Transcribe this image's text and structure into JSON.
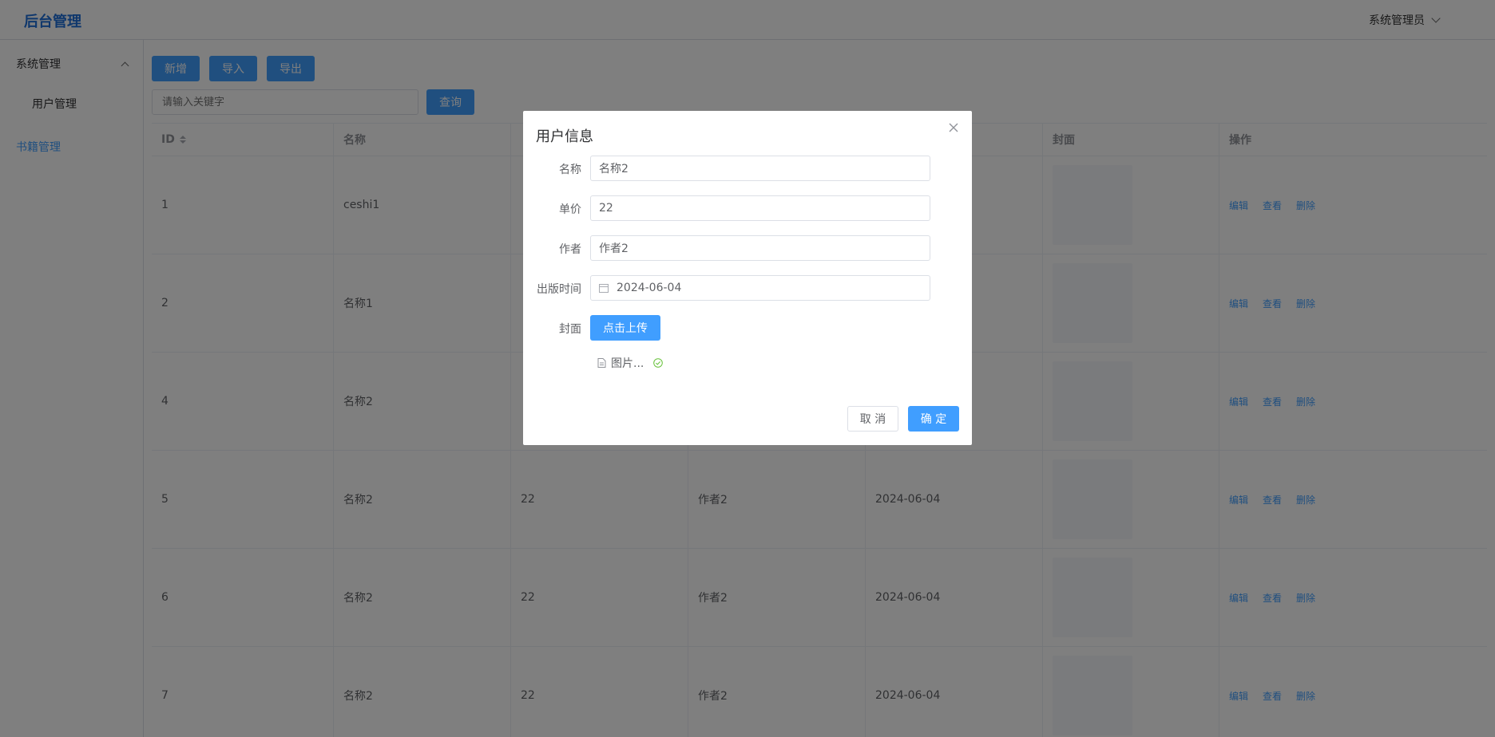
{
  "header": {
    "logo": "后台管理",
    "user": "系统管理员"
  },
  "sidebar": {
    "group": "系统管理",
    "sub_item": "用户管理",
    "active_item": "书籍管理"
  },
  "toolbar": {
    "add_label": "新增",
    "import_label": "导入",
    "export_label": "导出",
    "search_placeholder": "请输入关键字",
    "query_label": "查询"
  },
  "table": {
    "headers": [
      "ID",
      "名称",
      "",
      "",
      "",
      "封面",
      "操作"
    ],
    "rows": [
      {
        "id": "1",
        "name": "ceshi1",
        "price": "",
        "author": "",
        "date": ""
      },
      {
        "id": "2",
        "name": "名称1",
        "price": "",
        "author": "",
        "date": ""
      },
      {
        "id": "4",
        "name": "名称2",
        "price": "",
        "author": "",
        "date": ""
      },
      {
        "id": "5",
        "name": "名称2",
        "price": "22",
        "author": "作者2",
        "date": "2024-06-04"
      },
      {
        "id": "6",
        "name": "名称2",
        "price": "22",
        "author": "作者2",
        "date": "2024-06-04"
      },
      {
        "id": "7",
        "name": "名称2",
        "price": "22",
        "author": "作者2",
        "date": "2024-06-04"
      }
    ],
    "actions": {
      "edit": "编辑",
      "view": "查看",
      "delete": "删除"
    }
  },
  "dialog": {
    "title": "用户信息",
    "fields": {
      "name_label": "名称",
      "name_value": "名称2",
      "price_label": "单价",
      "price_value": "22",
      "author_label": "作者",
      "author_value": "作者2",
      "date_label": "出版时间",
      "date_value": "2024-06-04",
      "cover_label": "封面"
    },
    "upload_label": "点击上传",
    "file_name": "图片...",
    "cancel_label": "取 消",
    "confirm_label": "确 定"
  }
}
